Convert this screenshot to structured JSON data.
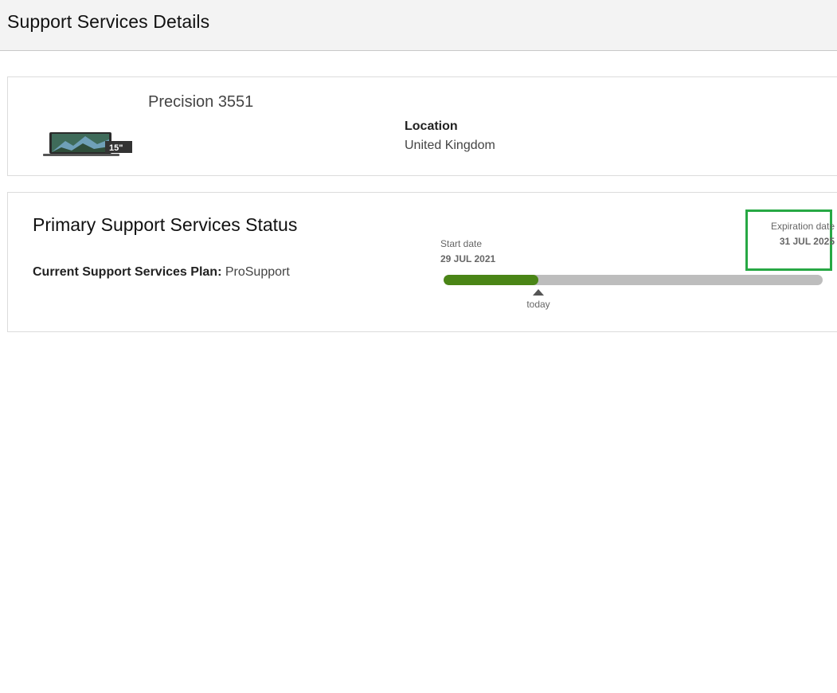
{
  "header": {
    "title": "Support Services Details"
  },
  "product": {
    "name": "Precision 3551",
    "image_badge": "15\"",
    "location_label": "Location",
    "location_value": "United Kingdom"
  },
  "status": {
    "title": "Primary Support Services Status",
    "plan_label": "Current Support Services Plan:",
    "plan_value": "ProSupport",
    "start_label": "Start date",
    "start_value": "29 JUL 2021",
    "expiration_label": "Expiration date",
    "expiration_value": "31 JUL 2025",
    "today_label": "today",
    "elapsed_fraction": 0.25
  },
  "colors": {
    "progress_fill": "#4a8516",
    "progress_track": "#bdbdbd",
    "highlight_box": "#27a844"
  },
  "icons": {
    "product_image": "laptop-icon",
    "today_marker": "triangle-up-icon"
  }
}
